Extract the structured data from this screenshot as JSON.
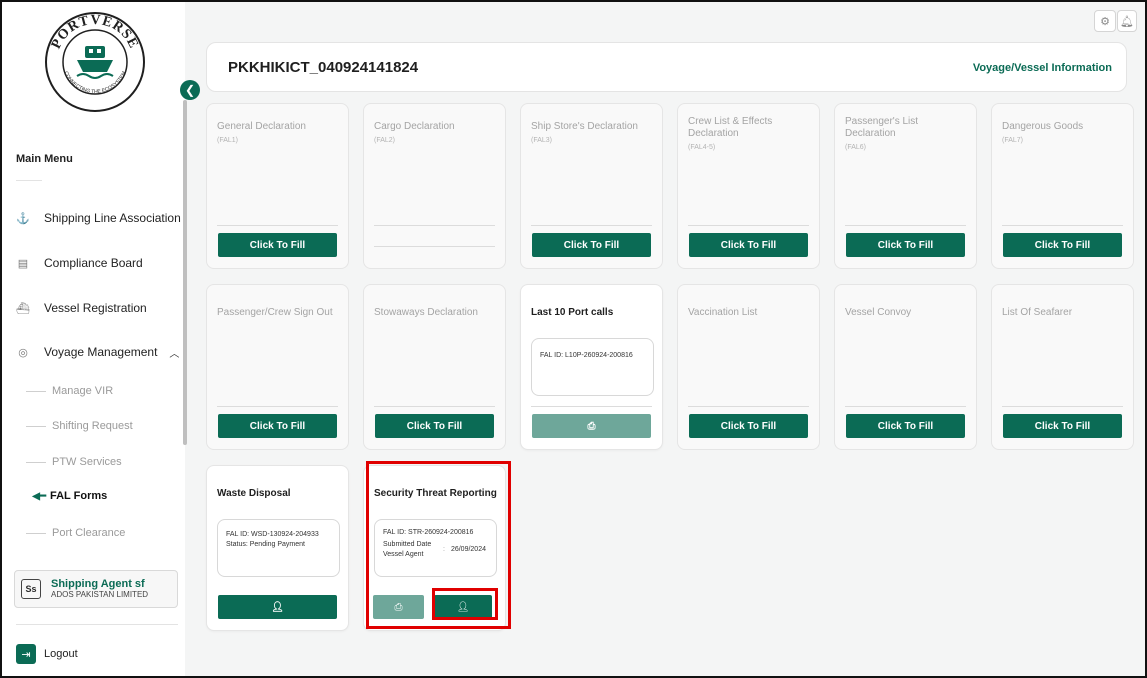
{
  "brand": {
    "name": "PORTVERSE",
    "tagline": "CONNECTING THE ECOSYSTEM"
  },
  "sidebar": {
    "main_menu": "Main Menu",
    "items": [
      {
        "label": "Shipping Line Association",
        "icon": "anchor-icon"
      },
      {
        "label": "Compliance Board",
        "icon": "document-icon"
      },
      {
        "label": "Vessel Registration",
        "icon": "ship-icon"
      },
      {
        "label": "Voyage Management",
        "icon": "compass-icon",
        "expanded": true
      }
    ],
    "sub_items": [
      "Manage VIR",
      "Shifting Request",
      "PTW Services",
      "FAL Forms",
      "Port Clearance"
    ],
    "active_sub_item": "FAL Forms",
    "user": {
      "initials": "Ss",
      "name": "Shipping Agent sf",
      "org": "ADOS PAKISTAN LIMITED"
    },
    "logout": "Logout"
  },
  "header": {
    "voyage_id": "PKKHIKICT_040924141824",
    "link": "Voyage/Vessel Information"
  },
  "cards": [
    {
      "title": "General Declaration",
      "code": "(FAL1)",
      "button": "Click To Fill"
    },
    {
      "title": "Cargo Declaration",
      "code": "(FAL2)",
      "button": ""
    },
    {
      "title": "Ship Store's Declaration",
      "code": "(FAL3)",
      "button": "Click To Fill"
    },
    {
      "title": "Crew List & Effects Declaration",
      "code": "(FAL4-5)",
      "button": "Click To Fill"
    },
    {
      "title": "Passenger's List Declaration",
      "code": "(FAL6)",
      "button": "Click To Fill"
    },
    {
      "title": "Dangerous Goods",
      "code": "(FAL7)",
      "button": "Click To Fill"
    },
    {
      "title": "Passenger/Crew Sign Out",
      "button": "Click To Fill"
    },
    {
      "title": "Stowaways Declaration",
      "button": "Click To Fill"
    },
    {
      "title": "Last 10 Port calls",
      "fal_id": "FAL ID: L10P-260924-200816"
    },
    {
      "title": "Vaccination List",
      "button": "Click To Fill"
    },
    {
      "title": "Vessel Convoy",
      "button": "Click To Fill"
    },
    {
      "title": "List Of Seafarer",
      "button": "Click To Fill"
    },
    {
      "title": "Waste Disposal",
      "fal_id": "FAL ID: WSD-130924-204933",
      "status": "Status: Pending Payment"
    },
    {
      "title": "Security Threat Reporting",
      "fal_id": "FAL ID: STR-260924-200816",
      "submitted_label": "Submitted Date",
      "submitted_sep": ":",
      "submitted_value": "26/09/2024",
      "agent_label": "Vessel Agent"
    }
  ],
  "colors": {
    "accent": "#0b6b55",
    "accent_light": "#6ea79a",
    "highlight": "#e00000"
  }
}
